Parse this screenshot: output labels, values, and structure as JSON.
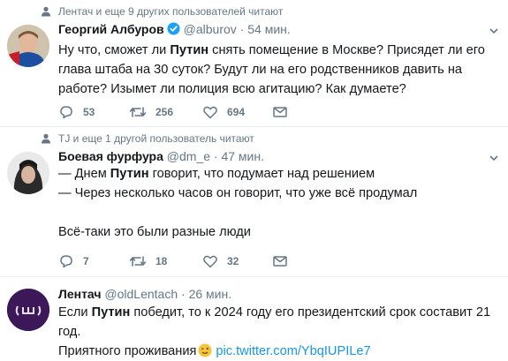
{
  "tweets": [
    {
      "context": "Лентач и еще 9 других пользователей читают",
      "name": "Георгий Албуров",
      "handle": "@alburov",
      "time": "54 мин.",
      "text_html": "Ну что, сможет ли <b>Путин</b> снять помещение в Москве? Присядет ли его глава штаба на 30 суток? Будут ли на его родственников давить на работе? Изымет ли полиция всю агитацию? Как думаете?",
      "replies": "53",
      "retweets": "256",
      "likes": "694"
    },
    {
      "context": "TJ и еще 1 другой пользователь читают",
      "name": "Боевая фурфура",
      "handle": "@dm_e",
      "time": "47 мин.",
      "text_html": "— Днем <b>Путин</b> говорит, что подумает над решением<br>— Через несколько часов он говорит, что уже всё продумал<br><br>Всё-таки это были разные люди",
      "replies": "7",
      "retweets": "18",
      "likes": "32"
    },
    {
      "name": "Лентач",
      "handle": "@oldLentach",
      "time": "26 мин.",
      "text_html": "Если <b>Путин</b> победит, то к 2024 году его президентский срок составит 21 год.<br>Приятного проживания",
      "link": "pic.twitter.com/YbqIUPILe7"
    }
  ],
  "separator": "·",
  "colors": {
    "link": "#1b95e0",
    "meta": "#657786",
    "divider": "#e6ecf0",
    "verified": "#1da1f2"
  },
  "icons": [
    "person-icon",
    "verified-icon",
    "chevron-down-icon",
    "reply-icon",
    "retweet-icon",
    "like-icon",
    "dm-icon",
    "wink-emoji-icon"
  ]
}
